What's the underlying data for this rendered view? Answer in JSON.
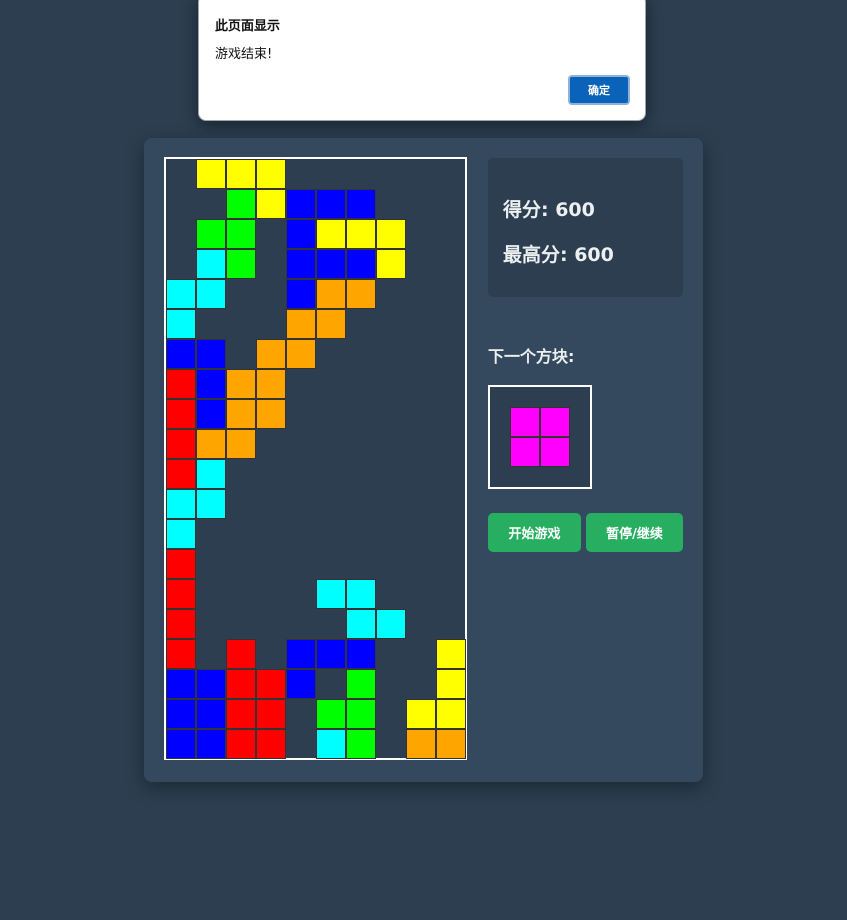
{
  "alert": {
    "title": "此页面显示",
    "message": "游戏结束!",
    "ok_label": "确定"
  },
  "score": {
    "current": "得分: 600",
    "best": "最高分: 600"
  },
  "next_piece": {
    "label": "下一个方块:",
    "shape": [
      [
        1,
        1
      ],
      [
        1,
        1
      ]
    ],
    "color": "#ff00ff"
  },
  "buttons": {
    "start_label": "开始游戏",
    "pause_label": "暂停/继续"
  },
  "colors": {
    "background": "#2c3e50",
    "container": "#34495e",
    "button": "#27ae60",
    "dialog_button": "#0b62b9"
  },
  "board": {
    "columns": 10,
    "rows": 20,
    "palette": {
      "Y": "#ffff00",
      "G": "#00ff00",
      "B": "#0000ff",
      "C": "#00ffff",
      "O": "#ffa500",
      "R": "#ff0000",
      "M": "#ff00ff"
    },
    "grid": [
      ".YYY......",
      "..GYBBB...",
      ".GG.BYYY..",
      ".CG.BBBY..",
      "CC..BOO...",
      "C...OO....",
      "BB.OO.....",
      "RBOO......",
      "RBOO......",
      "ROO.......",
      "RC........",
      "CC........",
      "C.........",
      "R.........",
      "R....CC...",
      "R.....CC..",
      "R.R.BBB..Y",
      "BBRRB.G..Y",
      "BBRR.GG.YY",
      "BBRR.CG.OO"
    ]
  }
}
